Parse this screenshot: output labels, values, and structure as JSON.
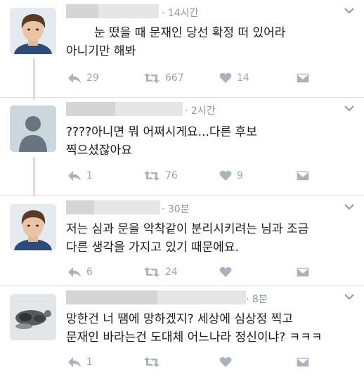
{
  "tweets": [
    {
      "time": "· 14시간",
      "text_lines": [
        "눈 떴을 때 문재인 당선 확정 떠 있어라",
        "아니기만 해봐"
      ],
      "replies": "29",
      "retweets": "667",
      "likes": "14"
    },
    {
      "time": "· 2시간",
      "text_lines": [
        "????아니면 뭐 어쩌시게요...다른 후보",
        "찍으셨잖아요"
      ],
      "replies": "1",
      "retweets": "76",
      "likes": "9"
    },
    {
      "time": "· 30분",
      "text_lines": [
        "저는 심과 문을 악착같이 분리시키려는 님과 조금",
        "다른 생각을 가지고 있기 때문에요."
      ],
      "replies": "6",
      "retweets": "24",
      "likes": ""
    },
    {
      "time": "· 8분",
      "text_lines": [
        "망한건 너 땜에 망하겠지? 세상에 심상정 찍고",
        "문재인 바라는건 도대체 어느나라 정신이냐? ㅋㅋㅋ"
      ],
      "replies": "1",
      "retweets": "",
      "likes": ""
    }
  ],
  "colors": {
    "icon": "#a8b3bd",
    "divider": "#d6dce1",
    "thread": "#d8dee3"
  },
  "icons": [
    "reply-icon",
    "retweet-icon",
    "like-icon",
    "dm-icon",
    "chevron-down-icon"
  ]
}
